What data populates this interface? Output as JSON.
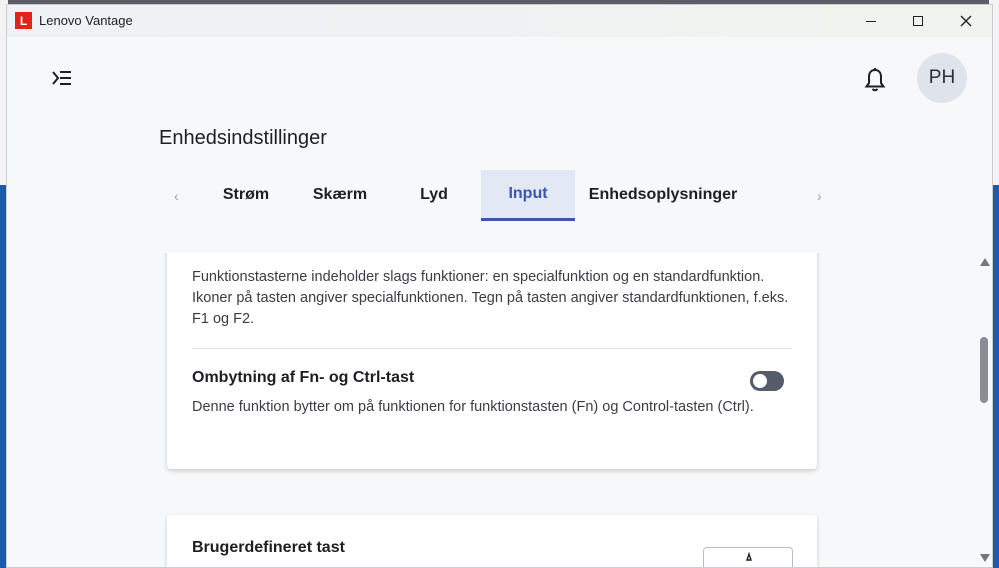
{
  "window": {
    "app_title": "Lenovo Vantage",
    "logo_letter": "L"
  },
  "header": {
    "avatar_initials": "PH"
  },
  "page": {
    "title": "Enhedsindstillinger"
  },
  "tabs": [
    {
      "label": "Strøm",
      "active": false
    },
    {
      "label": "Skærm",
      "active": false
    },
    {
      "label": "Lyd",
      "active": false
    },
    {
      "label": "Input",
      "active": true
    },
    {
      "label": "Enhedsoplysninger",
      "active": false
    }
  ],
  "function_keys": {
    "description": "Funktionstasterne indeholder slags funktioner: en specialfunktion og en standardfunktion. Ikoner på tasten angiver specialfunktionen. Tegn på tasten angiver standardfunktionen, f.eks. F1 og F2."
  },
  "fn_ctrl_swap": {
    "title": "Ombytning af Fn- og Ctrl-tast",
    "enabled": false,
    "description": "Denne funktion bytter om på funktionen for funktionstasten (Fn) og Control-tasten (Ctrl)."
  },
  "custom_key": {
    "title": "Brugerdefineret tast"
  },
  "colors": {
    "accent": "#3a55b7",
    "active_tab_bg": "#e3e8f5",
    "logo_red": "#e2231a",
    "toggle_off": "#545c6b"
  }
}
